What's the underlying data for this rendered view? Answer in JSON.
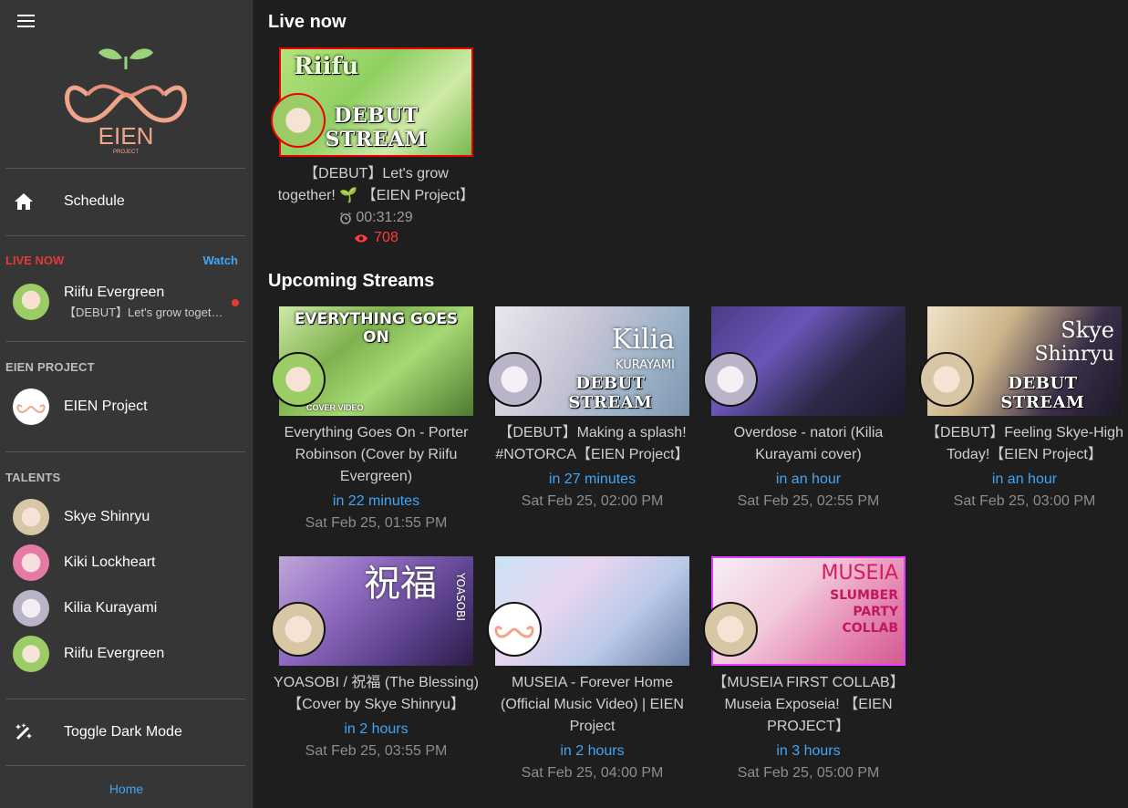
{
  "sidebar": {
    "logo_text": "EIEN",
    "logo_sub": "PROJECT",
    "schedule_label": "Schedule",
    "live_header": "LIVE NOW",
    "watch_label": "Watch",
    "live_item": {
      "name": "Riifu Evergreen",
      "title": "【DEBUT】Let's grow together! 🌱 【EIEN Project】"
    },
    "project_header": "EIEN PROJECT",
    "project_label": "EIEN Project",
    "talents_header": "TALENTS",
    "talents": [
      {
        "label": "Skye Shinryu"
      },
      {
        "label": "Kiki Lockheart"
      },
      {
        "label": "Kilia Kurayami"
      },
      {
        "label": "Riifu Evergreen"
      }
    ],
    "dark_mode_label": "Toggle Dark Mode",
    "home_label": "Home"
  },
  "main": {
    "live_title": "Live now",
    "upcoming_title": "Upcoming Streams",
    "live_card": {
      "thumb_top": "Riifu",
      "thumb_text": "DEBUT STREAM",
      "title": "【DEBUT】Let's grow together! 🌱 【EIEN Project】",
      "duration": "00:31:29",
      "viewers": "708"
    },
    "upcoming": [
      {
        "thumb_top": "EVERYTHING GOES ON",
        "thumb_text": "",
        "tag": "COVER VIDEO",
        "title": "Everything Goes On - Porter Robinson (Cover by Riifu Evergreen)",
        "relative": "in 22 minutes",
        "date": "Sat Feb 25, 01:55 PM"
      },
      {
        "thumb_top": "",
        "thumb_text": "DEBUT STREAM",
        "side": "Kilia",
        "side2": "KURAYAMI",
        "title": "【DEBUT】Making a splash! #NOTORCA【EIEN Project】",
        "relative": "in 27 minutes",
        "date": "Sat Feb 25, 02:00 PM"
      },
      {
        "thumb_top": "",
        "thumb_text": "",
        "title": "Overdose - natori (Kilia Kurayami cover)",
        "relative": "in an hour",
        "date": "Sat Feb 25, 02:55 PM"
      },
      {
        "thumb_top": "",
        "thumb_text": "DEBUT STREAM",
        "side": "Skye",
        "side2": "Shinryu",
        "title": "【DEBUT】Feeling Skye-High Today!【EIEN Project】",
        "relative": "in an hour",
        "date": "Sat Feb 25, 03:00 PM"
      },
      {
        "thumb_top": "",
        "thumb_text": "",
        "side": "祝福",
        "side2": "YOASOBI",
        "title": "YOASOBI / 祝福 (The Blessing)【Cover by Skye Shinryu】",
        "relative": "in 2 hours",
        "date": "Sat Feb 25, 03:55 PM"
      },
      {
        "thumb_top": "",
        "thumb_text": "",
        "title": "MUSEIA - Forever Home (Official Music Video) | EIEN Project",
        "relative": "in 2 hours",
        "date": "Sat Feb 25, 04:00 PM"
      },
      {
        "thumb_top": "",
        "thumb_text": "",
        "side": "MUSEIA",
        "side2": "SLUMBER PARTY COLLAB",
        "title": "【MUSEIA FIRST COLLAB】Museia Exposeia! 【EIEN PROJECT】",
        "relative": "in 3 hours",
        "date": "Sat Feb 25, 05:00 PM"
      }
    ]
  },
  "colors": {
    "accent_blue": "#42a5f5",
    "live_red": "#e53935",
    "sidebar_bg": "#363636",
    "main_bg": "#1e1e1e"
  }
}
